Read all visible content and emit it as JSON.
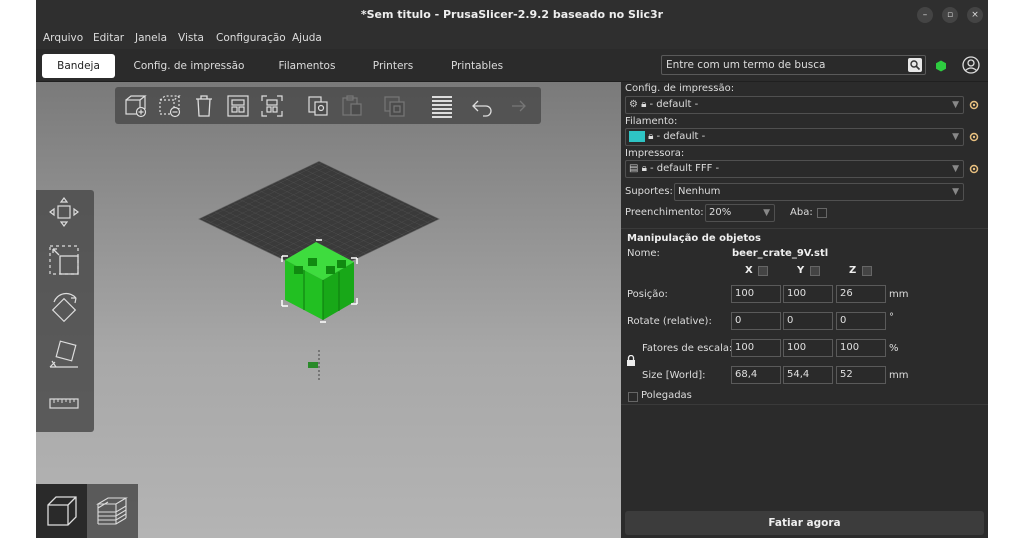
{
  "window": {
    "title": "*Sem titulo - PrusaSlicer-2.9.2 baseado no Slic3r",
    "controls": [
      "–",
      "▫",
      "×"
    ]
  },
  "menu": [
    "Arquivo",
    "Editar",
    "Janela",
    "Vista",
    "Configuração",
    "Ajuda"
  ],
  "tabs": [
    {
      "label": "Bandeja",
      "active": true
    },
    {
      "label": "Config. de impressão",
      "active": false
    },
    {
      "label": "Filamentos",
      "active": false
    },
    {
      "label": "Printers",
      "active": false
    },
    {
      "label": "Printables",
      "active": false
    }
  ],
  "search": {
    "placeholder": "Entre com um termo de busca"
  },
  "status_dot_color": "#2ecc40",
  "settings": {
    "print_label": "Config. de impressão:",
    "print_value": "- default -",
    "filament_label": "Filamento:",
    "filament_value": "- default -",
    "filament_color": "#2ec4c4",
    "printer_label": "Impressora:",
    "printer_value": "- default FFF -",
    "supports_label": "Suportes:",
    "supports_value": "Nenhum",
    "infill_label": "Preenchimento:",
    "infill_value": "20%",
    "brim_label": "Aba:"
  },
  "object_manip": {
    "title": "Manipulação de objetos",
    "name_label": "Nome:",
    "name_value": "beer_crate_9V.stl",
    "axes": [
      "X",
      "Y",
      "Z"
    ],
    "position_label": "Posição:",
    "position": [
      "100",
      "100",
      "26"
    ],
    "position_unit": "mm",
    "rotate_label": "Rotate (relative):",
    "rotate": [
      "0",
      "0",
      "0"
    ],
    "rotate_unit": "°",
    "scale_label": "Fatores de escala:",
    "scale": [
      "100",
      "100",
      "100"
    ],
    "scale_unit": "%",
    "size_label": "Size [World]:",
    "size": [
      "68,4",
      "54,4",
      "52"
    ],
    "size_unit": "mm",
    "inches_label": "Polegadas"
  },
  "slice_button": "Fatiar agora"
}
